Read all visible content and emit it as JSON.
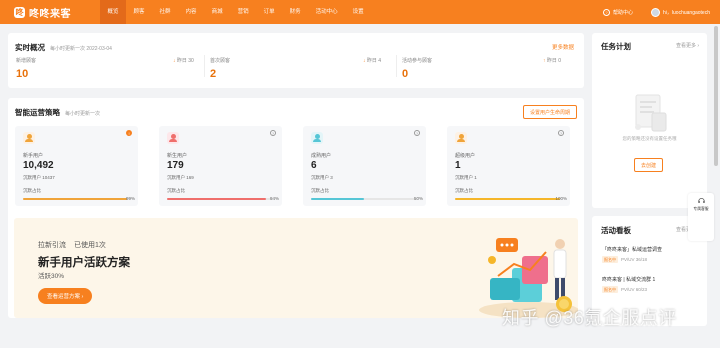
{
  "app": {
    "name": "咚咚来客"
  },
  "nav": [
    "概览",
    "顾客",
    "社群",
    "内容",
    "商城",
    "营销",
    "订单",
    "财务",
    "活动中心",
    "设置"
  ],
  "header_right": {
    "help": "帮助中心",
    "user": "hi，luochuangaotech"
  },
  "realtime": {
    "title": "实时概况",
    "subtitle": "每小时更新一次 2022-03-04",
    "more": "更多数据",
    "stats": [
      {
        "label": "新增顾客",
        "value": "10",
        "cmp": "昨日 30",
        "dir": "down"
      },
      {
        "label": "首次顾客",
        "value": "2",
        "cmp": "昨日 4",
        "dir": "down"
      },
      {
        "label": "活动参与顾客",
        "value": "0",
        "cmp": "昨日 0",
        "dir": "up"
      }
    ]
  },
  "strategy": {
    "title": "智能运营策略",
    "subtitle": "每小时更新一次",
    "button": "设置用户生命周期",
    "cards": [
      {
        "label": "新手用户",
        "value": "10,492",
        "sub": "沉默用户 10437",
        "bar_label": "沉默占比",
        "pct": "99%",
        "fill": 0.99,
        "color": "#f0a43a",
        "icon_bg": "#fdf1e4",
        "icon_color": "#f0a43a",
        "info_hot": true
      },
      {
        "label": "新生用户",
        "value": "179",
        "sub": "沉默用户 169",
        "bar_label": "沉默占比",
        "pct": "94%",
        "fill": 0.94,
        "color": "#ef6f6c",
        "icon_bg": "#fde7ea",
        "icon_color": "#ef6f6c",
        "info_hot": false
      },
      {
        "label": "成熟用户",
        "value": "6",
        "sub": "沉默用户 3",
        "bar_label": "沉默占比",
        "pct": "50%",
        "fill": 0.5,
        "color": "#56c6d6",
        "icon_bg": "#e3f5f8",
        "icon_color": "#56c6d6",
        "info_hot": false
      },
      {
        "label": "超级用户",
        "value": "1",
        "sub": "沉默用户 1",
        "bar_label": "沉默占比",
        "pct": "100%",
        "fill": 1.0,
        "color": "#f5b62a",
        "icon_bg": "#fdf1e4",
        "icon_color": "#f0a43a",
        "info_hot": false
      }
    ],
    "banner": {
      "tag1": "拉新引流",
      "tag2": "已使用1次",
      "title": "新手用户活跃方案",
      "sub": "活跃30%",
      "button": "查看运营方案 ›"
    }
  },
  "task": {
    "title": "任务计划",
    "more": "查看更多 ›",
    "empty": "您的策略还没有设置任务哦",
    "button": "去创建"
  },
  "activity": {
    "title": "活动看板",
    "more": "查看更多 ›",
    "items": [
      {
        "title": "「咚咚来客」私域运营调查",
        "tag": "报名中",
        "tag_color": "#f7801f",
        "meta": "PV/UV 36/18"
      },
      {
        "title": "咚咚来客 | 私域交流群 1",
        "tag": "报名中",
        "tag_color": "#f7801f",
        "meta": "PV/UV 60/23"
      }
    ]
  },
  "float": {
    "label": "专属客服"
  },
  "watermark": {
    "text": "知乎 @36氪企服点评"
  }
}
